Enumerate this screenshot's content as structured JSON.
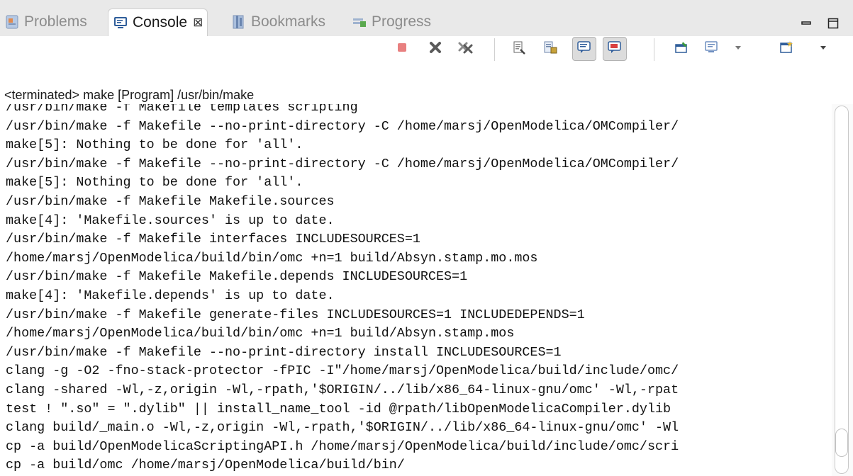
{
  "tabs": [
    {
      "label": "Problems",
      "icon": "problems-icon",
      "active": false
    },
    {
      "label": "Console",
      "icon": "console-icon",
      "active": true,
      "close": "⊠"
    },
    {
      "label": "Bookmarks",
      "icon": "bookmarks-icon",
      "active": false
    },
    {
      "label": "Progress",
      "icon": "progress-icon",
      "active": false
    }
  ],
  "window_controls": {
    "minimize": "▭",
    "maximize": "⊟"
  },
  "toolbar": {
    "items": [
      "terminate-icon",
      "remove-launch-icon",
      "remove-all-terminated-icon",
      "clear-console-icon",
      "scroll-lock-icon",
      "show-on-stdout-icon",
      "show-on-stderr-icon",
      "pin-console-icon",
      "display-console-icon",
      "console-dropdown-icon",
      "open-console-icon",
      "open-console-dropdown-icon"
    ]
  },
  "status": "<terminated> make [Program] /usr/bin/make",
  "console_lines": [
    "/usr/bin/make -f Makefile templates scripting",
    "/usr/bin/make -f Makefile --no-print-directory -C /home/marsj/OpenModelica/OMCompiler/",
    "make[5]: Nothing to be done for 'all'.",
    "/usr/bin/make -f Makefile --no-print-directory -C /home/marsj/OpenModelica/OMCompiler/",
    "make[5]: Nothing to be done for 'all'.",
    "/usr/bin/make -f Makefile Makefile.sources",
    "make[4]: 'Makefile.sources' is up to date.",
    "/usr/bin/make -f Makefile interfaces INCLUDESOURCES=1",
    "/home/marsj/OpenModelica/build/bin/omc +n=1 build/Absyn.stamp.mo.mos",
    "/usr/bin/make -f Makefile Makefile.depends INCLUDESOURCES=1",
    "make[4]: 'Makefile.depends' is up to date.",
    "/usr/bin/make -f Makefile generate-files INCLUDESOURCES=1 INCLUDEDEPENDS=1",
    "/home/marsj/OpenModelica/build/bin/omc +n=1 build/Absyn.stamp.mos",
    "/usr/bin/make -f Makefile --no-print-directory install INCLUDESOURCES=1",
    "clang -g -O2 -fno-stack-protector -fPIC -I\"/home/marsj/OpenModelica/build/include/omc/",
    "clang -shared -Wl,-z,origin -Wl,-rpath,'$ORIGIN/../lib/x86_64-linux-gnu/omc' -Wl,-rpat",
    "test ! \".so\" = \".dylib\" || install_name_tool -id @rpath/libOpenModelicaCompiler.dylib",
    "clang build/_main.o -Wl,-z,origin -Wl,-rpath,'$ORIGIN/../lib/x86_64-linux-gnu/omc' -Wl",
    "cp -a build/OpenModelicaScriptingAPI.h /home/marsj/OpenModelica/build/include/omc/scri",
    "cp -a build/omc /home/marsj/OpenModelica/build/bin/"
  ],
  "colors": {
    "tab_bg": "#e9e9e9",
    "active_tab_bg": "#ffffff",
    "inactive_text": "#8c8c8c",
    "terminate_red": "#e57373"
  }
}
